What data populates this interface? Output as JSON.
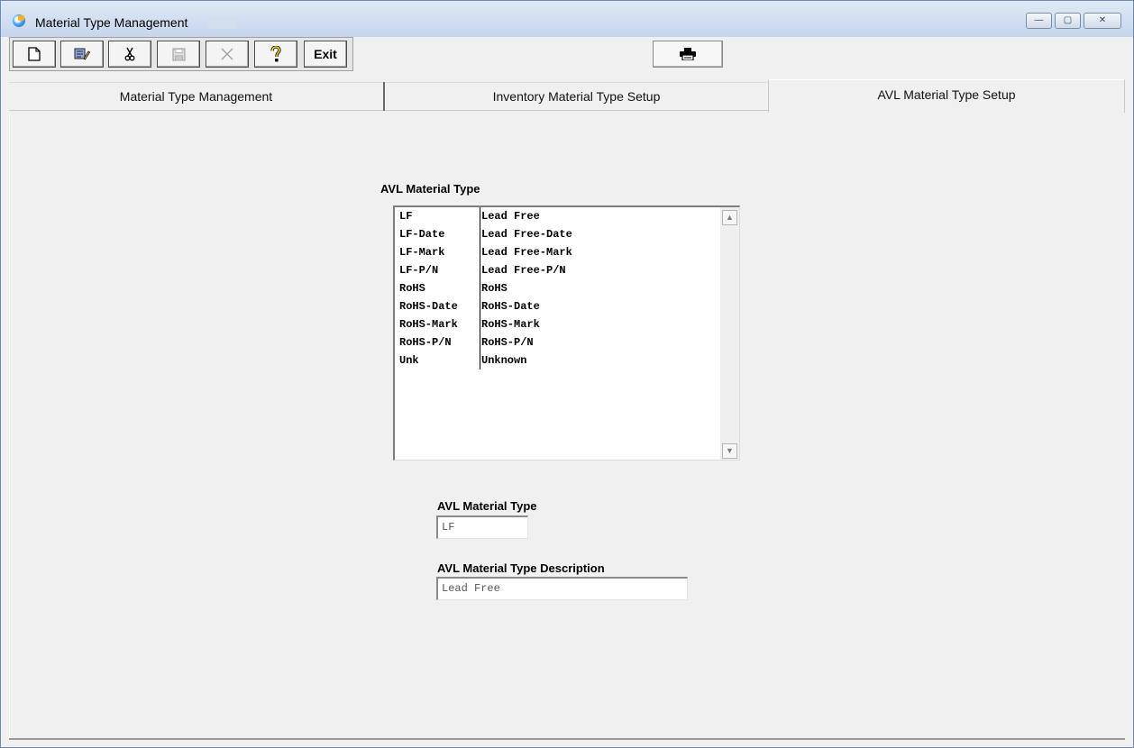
{
  "window": {
    "title": "Material Type Management",
    "controls": {
      "minimize": "—",
      "maximize": "▢",
      "close": "✕"
    }
  },
  "toolbar": {
    "buttons": [
      {
        "name": "new-button",
        "icon": "new-document-icon",
        "glyph": "🗋",
        "enabled": true
      },
      {
        "name": "edit-button",
        "icon": "edit-icon",
        "glyph": "✎",
        "enabled": true
      },
      {
        "name": "cut-button",
        "icon": "scissors-icon",
        "glyph": "✂",
        "enabled": true
      },
      {
        "name": "save-button",
        "icon": "floppy-disk-icon",
        "glyph": "💾",
        "enabled": false
      },
      {
        "name": "delete-button",
        "icon": "x-icon",
        "glyph": "✕",
        "enabled": false
      },
      {
        "name": "help-button",
        "icon": "help-question-icon",
        "glyph": "?",
        "enabled": true
      }
    ],
    "exit_label": "Exit",
    "print_icon": "printer-icon"
  },
  "tabs": [
    {
      "label": "Material Type Management",
      "active": false
    },
    {
      "label": "Inventory Material Type Setup",
      "active": false
    },
    {
      "label": "AVL Material Type Setup",
      "active": true
    }
  ],
  "avl_list": {
    "label": "AVL Material Type",
    "rows": [
      {
        "code": "LF",
        "description": "Lead Free"
      },
      {
        "code": "LF-Date",
        "description": "Lead Free-Date"
      },
      {
        "code": "LF-Mark",
        "description": "Lead Free-Mark"
      },
      {
        "code": "LF-P/N",
        "description": "Lead Free-P/N"
      },
      {
        "code": "RoHS",
        "description": "RoHS"
      },
      {
        "code": "RoHS-Date",
        "description": "RoHS-Date"
      },
      {
        "code": "RoHS-Mark",
        "description": "RoHS-Mark"
      },
      {
        "code": "RoHS-P/N",
        "description": "RoHS-P/N"
      },
      {
        "code": "Unk",
        "description": "Unknown"
      }
    ]
  },
  "form": {
    "type_label": "AVL Material Type",
    "type_value": "LF",
    "desc_label": "AVL Material Type Description",
    "desc_value": "Lead Free"
  }
}
